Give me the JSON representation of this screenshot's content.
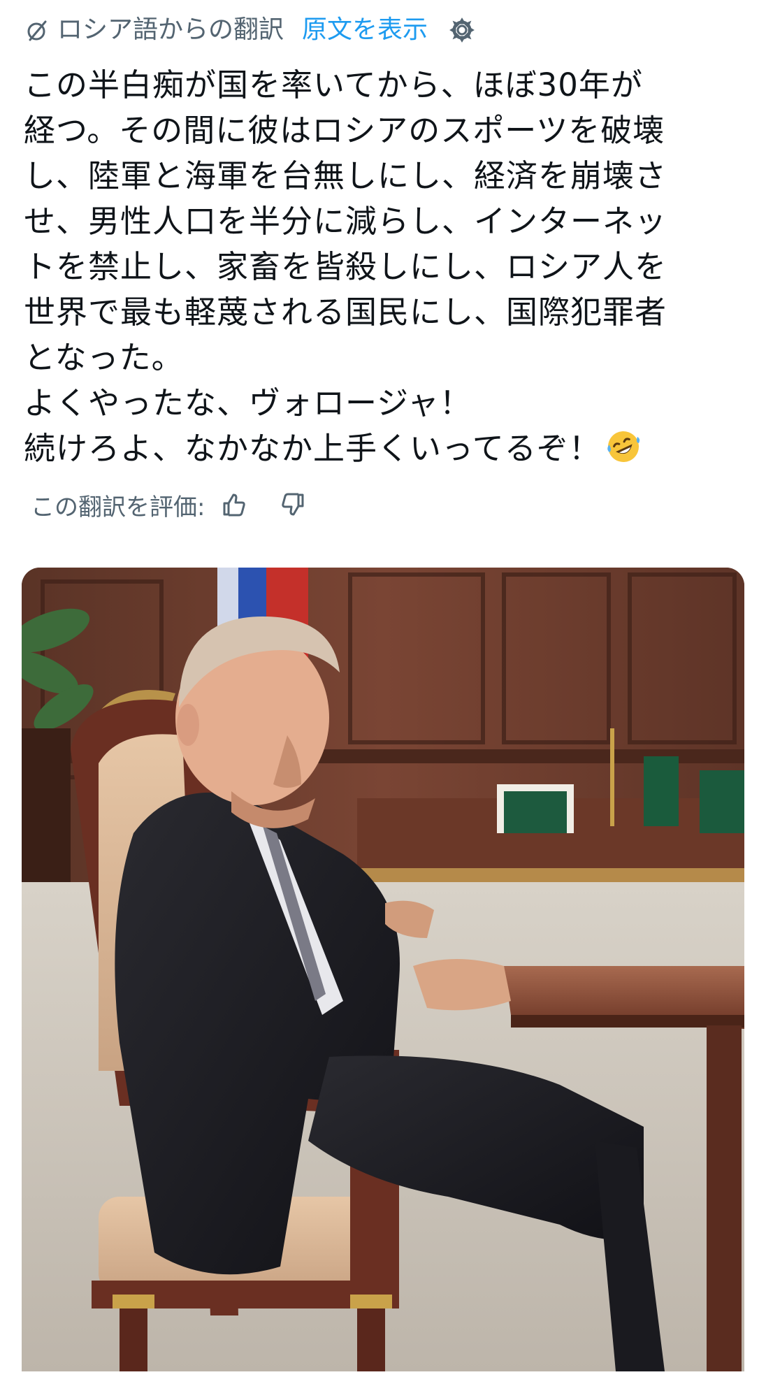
{
  "translation_bar": {
    "translated_from": "ロシア語からの翻訳",
    "show_original": "原文を表示",
    "translate_icon": "translate-icon",
    "settings_icon": "gear-icon"
  },
  "tweet": {
    "lines": [
      "この半白痴が国を率いてから、ほぼ30年が",
      "経つ。その間に彼はロシアのスポーツを破壊",
      "し、陸軍と海軍を台無しにし、経済を崩壊さ",
      "せ、男性人口を半分に減らし、インターネッ",
      "トを禁止し、家畜を皆殺しにし、ロシア人を",
      "世界で最も軽蔑される国民にし、国際犯罪者",
      "となった。",
      "よくやったな、ヴォロージャ！",
      "続けろよ、なかなか上手くいってるぞ！"
    ],
    "emoji": "rolling-on-floor-laughing-emoji"
  },
  "rating": {
    "label": "この翻訳を評価:",
    "thumbs_up_icon": "thumbs-up-icon",
    "thumbs_down_icon": "thumbs-down-icon"
  },
  "media": {
    "subject": "photo-of-man-in-dark-suit-seated-in-ornate-chair-beside-wooden-desk"
  },
  "colors": {
    "text": "#0f1419",
    "secondary": "#536471",
    "link": "#1d9bf0"
  }
}
